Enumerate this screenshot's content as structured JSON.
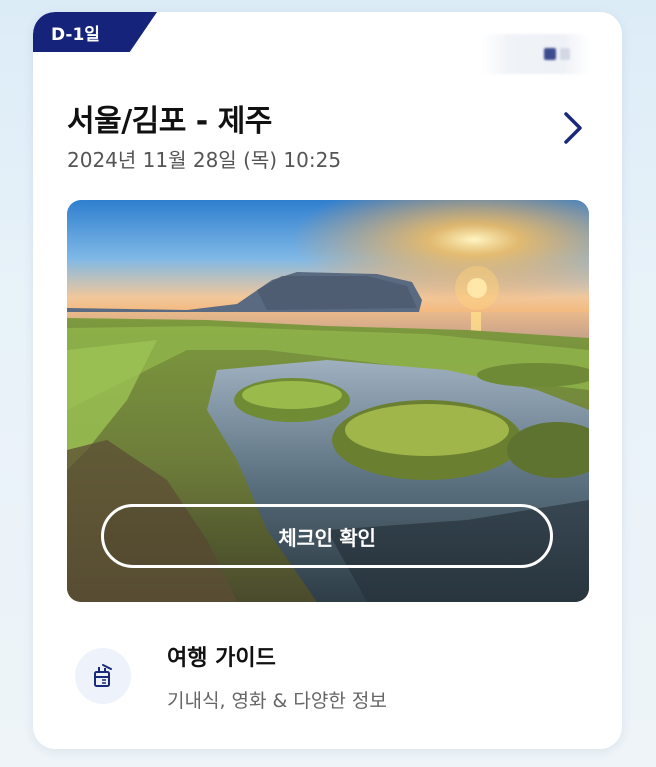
{
  "card": {
    "dday_badge": "D-1일",
    "route": "서울/김포 - 제주",
    "datetime": "2024년 11월 28일 (목) 10:25",
    "checkin_label": "체크인 확인"
  },
  "guide": {
    "title": "여행 가이드",
    "subtitle": "기내식, 영화 & 다양한 정보"
  },
  "colors": {
    "accent": "#16237a",
    "chevron": "#1a2a7a"
  },
  "icons": {
    "chevron": "chevron-right-icon",
    "guide": "travel-guide-icon"
  }
}
